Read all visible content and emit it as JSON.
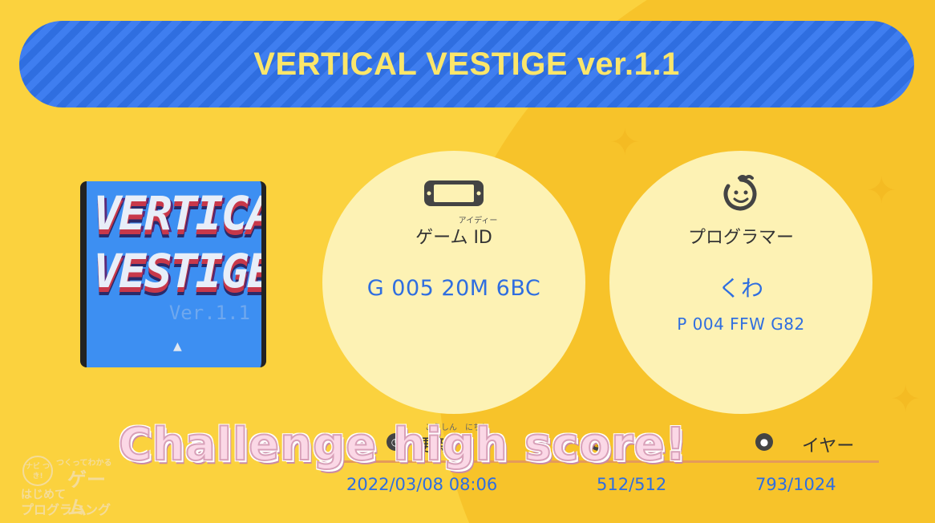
{
  "game": {
    "title": "VERTICAL VESTIGE ver.1.1"
  },
  "thumbnail": {
    "line1": "VERTICAL",
    "line2": "VESTIGE",
    "version": "Ver.1.1"
  },
  "game_id_card": {
    "icon": "switch-console-icon",
    "ruby": "アイディー",
    "label": "ゲーム ID",
    "value": "G 005 20M 6BC"
  },
  "programmer_card": {
    "icon": "smiling-face-icon",
    "label": "プログラマー",
    "name": "くわ",
    "id": "P 004 FFW G82"
  },
  "stats": {
    "updated": {
      "ruby": "こうしん　にちじ",
      "label": "更新",
      "value": "2022/03/08 08:06"
    },
    "nodes": {
      "icon": "lock-icon",
      "value": "512/512"
    },
    "players": {
      "label": "イヤー",
      "value": "793/1024"
    }
  },
  "overlay_caption": "Challenge high score!",
  "logo": {
    "badge": "ナビ つき!",
    "subtitle": "つくってわかる",
    "word_game": "ゲーム",
    "line1": "はじめて",
    "line2": "プログラミング"
  },
  "colors": {
    "background": "#fbd23e",
    "title_bar": "#2f6ee0",
    "title_text": "#fbe66a",
    "circle": "#fdf2b4",
    "value_text": "#2f6ee0"
  }
}
